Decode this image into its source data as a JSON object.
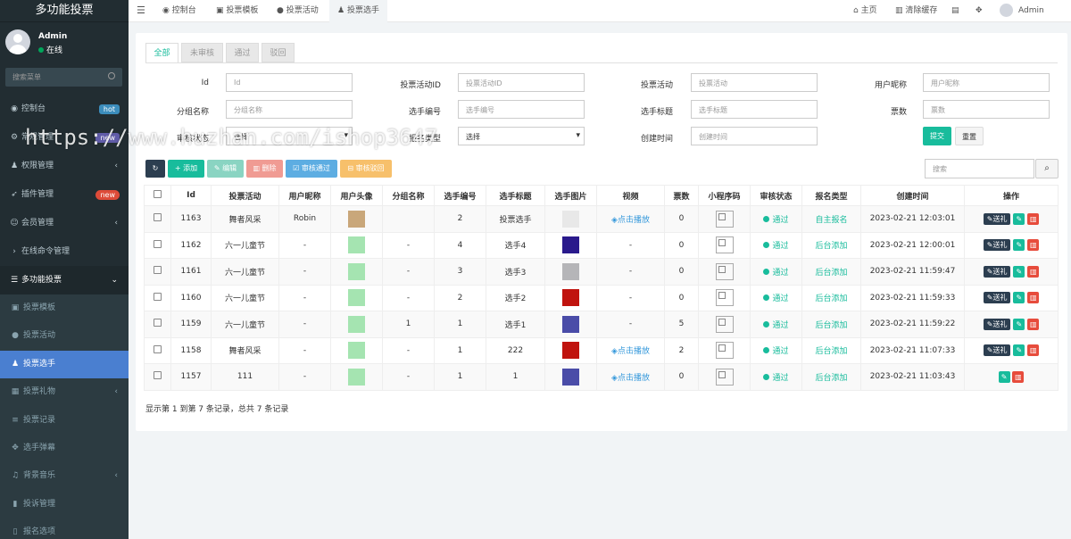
{
  "sidebar": {
    "brand": "多功能投票",
    "user": {
      "name": "Admin",
      "status": "在线"
    },
    "search_placeholder": "搜索菜单",
    "items": [
      {
        "label": "控制台",
        "icon": "dashboard-icon",
        "badge": "hot"
      },
      {
        "label": "常规管理",
        "icon": "cogs-icon",
        "badge": "new"
      },
      {
        "label": "权限管理",
        "icon": "group-icon",
        "caret": "‹"
      },
      {
        "label": "插件管理",
        "icon": "rocket-icon",
        "badge": "new"
      },
      {
        "label": "会员管理",
        "icon": "user-circle-icon",
        "caret": "‹"
      },
      {
        "label": "在线命令管理",
        "icon": "terminal-icon"
      },
      {
        "label": "多功能投票",
        "icon": "list-icon",
        "caret": "⌄"
      }
    ],
    "subitems": [
      {
        "label": "投票模板",
        "icon": "image-icon"
      },
      {
        "label": "投票活动",
        "icon": "bomb-icon"
      },
      {
        "label": "投票选手",
        "icon": "user-plus-icon"
      },
      {
        "label": "投票礼物",
        "icon": "gift-icon",
        "caret": "‹"
      },
      {
        "label": "投票记录",
        "icon": "list-alt-icon"
      },
      {
        "label": "选手弹幕",
        "icon": "arrows-icon"
      },
      {
        "label": "背景音乐",
        "icon": "music-icon",
        "caret": "‹"
      },
      {
        "label": "投诉管理",
        "icon": "bookmark-icon"
      },
      {
        "label": "报名选项",
        "icon": "file-icon"
      }
    ]
  },
  "topbar": {
    "tabs": [
      "控制台",
      "投票模板",
      "投票活动",
      "投票选手"
    ],
    "right": [
      "主页",
      "清除缓存"
    ],
    "admin": "Admin"
  },
  "page_tabs": [
    "全部",
    "未审核",
    "通过",
    "驳回"
  ],
  "filters": {
    "row1": [
      {
        "label": "Id",
        "placeholder": "Id"
      },
      {
        "label": "投票活动ID",
        "placeholder": "投票活动ID"
      },
      {
        "label": "投票活动",
        "placeholder": "投票活动"
      },
      {
        "label": "用户昵称",
        "placeholder": "用户昵称"
      }
    ],
    "row2": [
      {
        "label": "分组名称",
        "placeholder": "分组名称"
      },
      {
        "label": "选手编号",
        "placeholder": "选手编号"
      },
      {
        "label": "选手标题",
        "placeholder": "选手标题"
      },
      {
        "label": "票数",
        "placeholder": "票数"
      }
    ],
    "row3": [
      {
        "label": "审核状态",
        "value": "选择"
      },
      {
        "label": "报名类型",
        "value": "选择"
      },
      {
        "label": "创建时间",
        "placeholder": "创建时间"
      }
    ],
    "submit": "提交",
    "reset": "重置"
  },
  "toolbar": {
    "add": "添加",
    "edit": "编辑",
    "delete": "删除",
    "approve": "审核通过",
    "reject": "审核驳回",
    "search_placeholder": "搜索"
  },
  "table": {
    "headers": [
      "Id",
      "投票活动",
      "用户昵称",
      "用户头像",
      "分组名称",
      "选手编号",
      "选手标题",
      "选手图片",
      "视频",
      "票数",
      "小程序码",
      "审核状态",
      "报名类型",
      "创建时间",
      "操作"
    ],
    "rows": [
      {
        "id": "1163",
        "activity": "舞者风采",
        "nick": "Robin",
        "avatar_color": "#c9a77a",
        "group": "",
        "num": "2",
        "title": "投票选手",
        "img_color": "#e8e8e8",
        "video": "点击播放",
        "votes": "0",
        "status": "通过",
        "type": "自主报名",
        "time": "2023-02-21 12:03:01",
        "push": "送礼"
      },
      {
        "id": "1162",
        "activity": "六一儿童节",
        "nick": "-",
        "avatar_color": "#a5e4b1",
        "group": "-",
        "num": "4",
        "title": "选手4",
        "img_color": "#2a1a8c",
        "video": "-",
        "votes": "0",
        "status": "通过",
        "type": "后台添加",
        "time": "2023-02-21 12:00:01",
        "push": "送礼"
      },
      {
        "id": "1161",
        "activity": "六一儿童节",
        "nick": "-",
        "avatar_color": "#a5e4b1",
        "group": "-",
        "num": "3",
        "title": "选手3",
        "img_color": "#b5b5b8",
        "video": "-",
        "votes": "0",
        "status": "通过",
        "type": "后台添加",
        "time": "2023-02-21 11:59:47",
        "push": "送礼"
      },
      {
        "id": "1160",
        "activity": "六一儿童节",
        "nick": "-",
        "avatar_color": "#a5e4b1",
        "group": "-",
        "num": "2",
        "title": "选手2",
        "img_color": "#c0130e",
        "video": "-",
        "votes": "0",
        "status": "通过",
        "type": "后台添加",
        "time": "2023-02-21 11:59:33",
        "push": "送礼"
      },
      {
        "id": "1159",
        "activity": "六一儿童节",
        "nick": "-",
        "avatar_color": "#a5e4b1",
        "group": "1",
        "num": "1",
        "title": "选手1",
        "img_color": "#4a4ca8",
        "video": "-",
        "votes": "5",
        "status": "通过",
        "type": "后台添加",
        "time": "2023-02-21 11:59:22",
        "push": "送礼"
      },
      {
        "id": "1158",
        "activity": "舞者风采",
        "nick": "-",
        "avatar_color": "#a5e4b1",
        "group": "-",
        "num": "1",
        "title": "222",
        "img_color": "#c0130e",
        "video": "点击播放",
        "votes": "2",
        "status": "通过",
        "type": "后台添加",
        "time": "2023-02-21 11:07:33",
        "push": "送礼"
      },
      {
        "id": "1157",
        "activity": "111",
        "nick": "-",
        "avatar_color": "#a5e4b1",
        "group": "-",
        "num": "1",
        "title": "1",
        "img_color": "#4a4ca8",
        "video": "点击播放",
        "votes": "0",
        "status": "通过",
        "type": "后台添加",
        "time": "2023-02-21 11:03:43",
        "push": ""
      }
    ]
  },
  "footer": "显示第 1 到第 7 条记录，总共 7 条记录",
  "watermark": "https://www.huzhan.com/ishop3647"
}
